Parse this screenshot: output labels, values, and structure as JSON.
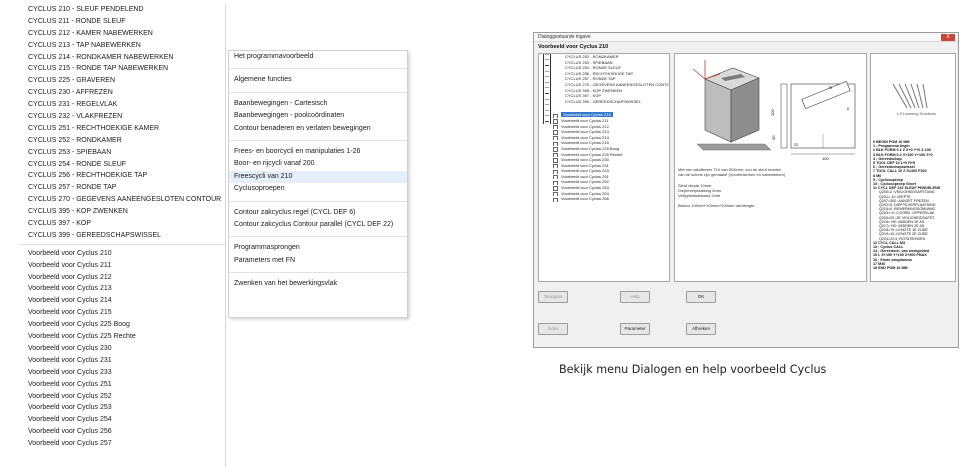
{
  "left_menu": {
    "cyclus_items": [
      "CYCLUS 210 - SLEUF PENDELEND",
      "CYCLUS 211 - RONDE SLEUF",
      "CYCLUS 212 - KAMER NABEWERKEN",
      "CYCLUS 213 - TAP NABEWERKEN",
      "CYCLUS 214 - RONDKAMER NABEWERKEN",
      "CYCLUS 215 - RONDE TAP NABEWERKEN",
      "CYCLUS 225 - GRAVEREN",
      "CYCLUS 230 - AFFREZEN",
      "CYCLUS 231 - REGELVLAK",
      "CYCLUS 232 - VLAKFREZEN",
      "CYCLUS 251 - RECHTHOEKIGE KAMER",
      "CYCLUS 252 - RONDKAMER",
      "CYCLUS 253 - SPIEBAAN",
      "CYCLUS 254 - RONDE SLEUF",
      "CYCLUS 256 - RECHTHOEKIGE TAP",
      "CYCLUS 257 - RONDE TAP",
      "CYCLUS 270 - GEGEVENS AANEENGESLOTEN CONTOUR",
      "CYCLUS 395 - KOP ZWENKEN",
      "CYCLUS 397 - KOP",
      "CYCLUS 399 - GEREEDSCHAPSWISSEL"
    ],
    "voorbeeld_items": [
      "Voorbeeld voor Cyclus 210",
      "Voorbeeld voor Cyclus 211",
      "Voorbeeld voor Cyclus 212",
      "Voorbeeld voor Cyclus 213",
      "Voorbeeld voor Cyclus 214",
      "Voorbeeld voor Cyclus 215",
      "Voorbeeld voor Cyclus 225 Boog",
      "Voorbeeld voor Cyclus 225 Rechte",
      "Voorbeeld voor Cyclus 230",
      "Voorbeeld voor Cyclus 231",
      "Voorbeeld voor Cyclus 233",
      "Voorbeeld voor Cyclus 251",
      "Voorbeeld voor Cyclus 252",
      "Voorbeeld voor Cyclus 253",
      "Voorbeeld voor Cyclus 254",
      "Voorbeeld voor Cyclus 256",
      "Voorbeeld voor Cyclus 257"
    ]
  },
  "sub_menu": {
    "groups": [
      [
        "Het programmavoorbeeld"
      ],
      [
        "Algemene functies"
      ],
      [
        "Baanbewegingen - Cartesisch",
        "Baanbewegingen - poolcoördinaten",
        "Contour benaderen en verlaten bewegingen"
      ],
      [
        "Frees- en boorcycli en manipulaties 1-26",
        "Boor- en rijcycli vanaf 200",
        "Freescycli van 210",
        "Cyclusoproepen"
      ],
      [
        "Contour zakcyclus  regel (CYCL DEF 6)",
        "Contour zakcyclus Contour parallel (CYCL DEF 22)"
      ],
      [
        "Programmasprongen",
        "Parameters met FN"
      ],
      [
        "Zwenken van het bewerkingsvlak"
      ]
    ],
    "highlighted": "Freescycli van 210"
  },
  "dialog": {
    "title": "Dialoggestuurde ingave",
    "close_label": "X",
    "header": "Voorbeeld voor Cyclus 210",
    "tree_cyclus": [
      "CYCLUS 252 - RONDKAMER",
      "CYCLUS 253 - SPIEBAAN",
      "CYCLUS 254 - RONDE SLEUF",
      "CYCLUS 256 - RECHTHOEKIGE TAP",
      "CYCLUS 257 - RONDE TAP",
      "CYCLUS 270 - GEGEVENS AANEENGESLOTEN CONTO",
      "CYCLUS 395 - KOP ZWENKEN",
      "CYCLUS 397 - KOP",
      "CYCLUS 399 - GEREEDSCHAPSWISSEL"
    ],
    "tree_voorbeeld": [
      "Voorbeeld voor Cyclus 210",
      "Voorbeeld voor Cyclus 211",
      "Voorbeeld voor Cyclus 212",
      "Voorbeeld voor Cyclus 213",
      "Voorbeeld voor Cyclus 214",
      "Voorbeeld voor Cyclus 215",
      "Voorbeeld voor Cyclus 225 Boog",
      "Voorbeeld voor Cyclus 225 Rechte",
      "Voorbeeld voor Cyclus 230",
      "Voorbeeld voor Cyclus 231",
      "Voorbeeld voor Cyclus 233",
      "Voorbeeld voor Cyclus 251",
      "Voorbeeld voor Cyclus 252",
      "Voorbeeld voor Cyclus 253",
      "Voorbeeld voor Cyclus 254",
      "Voorbeeld voor Cyclus 256"
    ],
    "selected": "Voorbeeld voor Cyclus 210",
    "dims": {
      "h": "100",
      "v": "30",
      "w": "100",
      "small": "22",
      "s75": "75",
      "s6": "6"
    },
    "description": [
      "Met een sleuffrezer T10 van Ø10mm, zou de sleuf moeten",
      "van de schets zijn gemaakt! (Voorbewerken en nabewerken)",
      "",
      "Sleuf diepte 10mm",
      "Diepteverplaatsing 5mm",
      "Veiligheidsafstand 2mm",
      "",
      "Blanco 100mm*100mm*100mm randlengte"
    ],
    "brand": "LS Learning Solutions",
    "code_lines": [
      {
        "t": "0  BEGIN PGM 10 MM",
        "sub": false
      },
      {
        "t": "1  ; Programma begin",
        "sub": false
      },
      {
        "t": "2  BLK FORM 0.1 Z  X+0 Y+0 Z-100",
        "sub": false
      },
      {
        "t": "3  BLK FORM 0.2 X+100  Y+100  Z+0",
        "sub": false
      },
      {
        "t": "4  ; Gereedschap",
        "sub": false
      },
      {
        "t": "5  TOOL DEF 10 L+0  R+5",
        "sub": false
      },
      {
        "t": "6  ; Gereedschapswissel",
        "sub": false
      },
      {
        "t": "7  TOOL CALL 10 Z  S1400 F100",
        "sub": false
      },
      {
        "t": "8  M6",
        "sub": false
      },
      {
        "t": "9  ; Cyclusoproep",
        "sub": false
      },
      {
        "t": "10  ; Cyclusoproep Groef",
        "sub": false
      },
      {
        "t": "11  CYCL DEF 210 SLEUF PENDELEND",
        "sub": false
      },
      {
        "t": "Q200=2 ;VEILIGHEIDSAFSTAND",
        "sub": true
      },
      {
        "t": "Q201=-10 ;DIEPTE",
        "sub": true
      },
      {
        "t": "Q207=300 ;AANZET FREZEN",
        "sub": true
      },
      {
        "t": "Q202=5 ;DIEPTEVERPLAATSING",
        "sub": true
      },
      {
        "t": "Q215=0 ;BEWERKINGSOMVANG",
        "sub": true
      },
      {
        "t": "Q203=+0 ;COORD. OPPERVLAK",
        "sub": true
      },
      {
        "t": "Q204=20 ;2E VEILIGHEIDSAFST.",
        "sub": true
      },
      {
        "t": "Q216=+50 ;MIDDEN 1E AS",
        "sub": true
      },
      {
        "t": "Q217=+50 ;MIDDEN 2E AS",
        "sub": true
      },
      {
        "t": "Q218=75 ;LENGTE 1E ZIJDE",
        "sub": true
      },
      {
        "t": "Q219=10 ;LENGTE 2E ZIJDE",
        "sub": true
      },
      {
        "t": "Q224=22.5 ;ROTATIEHOEK",
        "sub": true
      },
      {
        "t": "12  CYCL CALL M3",
        "sub": false
      },
      {
        "t": "13  ; Cyclus CALL",
        "sub": false
      },
      {
        "t": "14  ; Gereedsch. van werkgebied",
        "sub": false
      },
      {
        "t": "15  L  X+150  Y+150  Z+200 FMAX",
        "sub": false
      },
      {
        "t": "16  ; Einde programma",
        "sub": false
      },
      {
        "t": "17  M30",
        "sub": false
      },
      {
        "t": "18  END PGM 10 MM",
        "sub": false
      }
    ],
    "buttons": {
      "terug": "Terugaan",
      "help": "Help",
      "ok": "OK",
      "index": "Index",
      "parameter": "Parameter",
      "afbreken": "Afbreken"
    }
  },
  "caption": "Bekijk menu Dialogen en help voorbeeld Cyclus",
  "colors": {
    "selection": "#3377cc",
    "menu_highlight": "#e5eef9",
    "close": "#c7453a"
  }
}
